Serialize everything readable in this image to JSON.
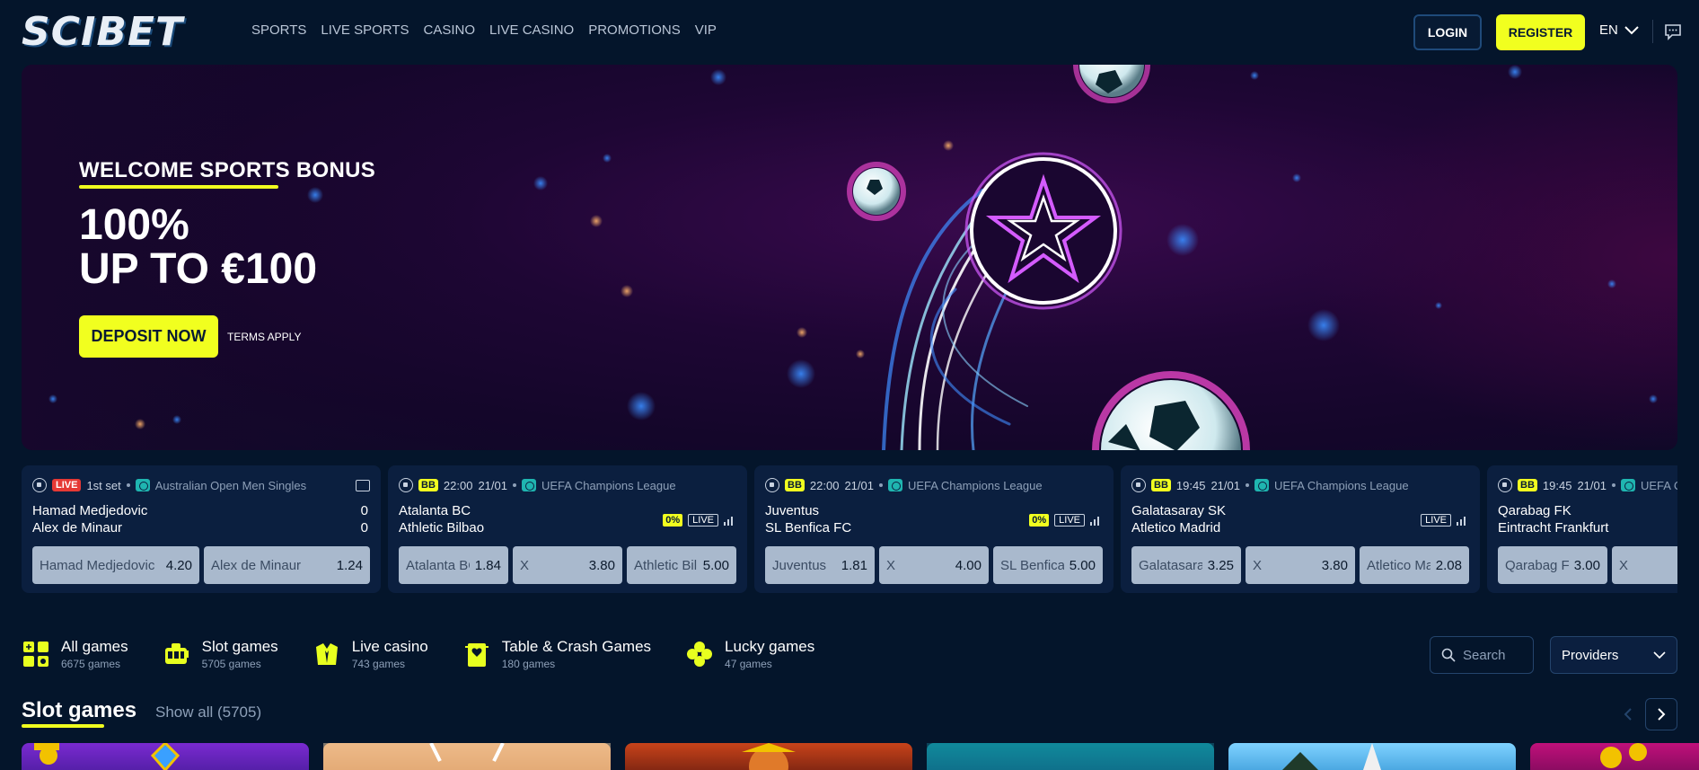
{
  "header": {
    "logo": "SCIBET",
    "nav": [
      "SPORTS",
      "LIVE SPORTS",
      "CASINO",
      "LIVE CASINO",
      "PROMOTIONS",
      "VIP"
    ],
    "login_label": "LOGIN",
    "register_label": "REGISTER",
    "language": "EN"
  },
  "hero": {
    "subtitle": "WELCOME SPORTS BONUS",
    "title_line1": "100%",
    "title_line2": "UP TO €100",
    "cta_label": "DEPOSIT NOW",
    "terms_label": "TERMS APPLY",
    "accent_color": "#f1ff1f"
  },
  "matches": [
    {
      "badge": "LIVE",
      "time": "1st set",
      "date": "",
      "league": "Australian Open Men Singles",
      "sport_icon": "tennis-icon",
      "home": "Hamad Medjedovic",
      "away": "Alex de Minaur",
      "home_score": "0",
      "away_score": "0",
      "tags": [],
      "odds": [
        {
          "name": "Hamad Medjedovic",
          "value": "4.20"
        },
        {
          "name": "Alex de Minaur",
          "value": "1.24"
        }
      ]
    },
    {
      "badge": "BB",
      "time": "22:00",
      "date": "21/01",
      "league": "UEFA Champions League",
      "sport_icon": "football-icon",
      "home": "Atalanta BC",
      "away": "Athletic Bilbao",
      "tags": [
        "0%",
        "LIVE"
      ],
      "odds": [
        {
          "name": "Atalanta BC",
          "value": "1.84"
        },
        {
          "name": "X",
          "value": "3.80"
        },
        {
          "name": "Athletic Bilbao",
          "value": "5.00"
        }
      ]
    },
    {
      "badge": "BB",
      "time": "22:00",
      "date": "21/01",
      "league": "UEFA Champions League",
      "sport_icon": "football-icon",
      "home": "Juventus",
      "away": "SL Benfica FC",
      "tags": [
        "0%",
        "LIVE"
      ],
      "odds": [
        {
          "name": "Juventus",
          "value": "1.81"
        },
        {
          "name": "X",
          "value": "4.00"
        },
        {
          "name": "SL Benfica FC",
          "value": "5.00"
        }
      ]
    },
    {
      "badge": "BB",
      "time": "19:45",
      "date": "21/01",
      "league": "UEFA Champions League",
      "sport_icon": "football-icon",
      "home": "Galatasaray SK",
      "away": "Atletico Madrid",
      "tags": [
        "LIVE"
      ],
      "odds": [
        {
          "name": "Galatasaray SK",
          "value": "3.25"
        },
        {
          "name": "X",
          "value": "3.80"
        },
        {
          "name": "Atletico Madrid",
          "value": "2.08"
        }
      ]
    },
    {
      "badge": "BB",
      "time": "19:45",
      "date": "21/01",
      "league": "UEFA Champions League",
      "sport_icon": "football-icon",
      "home": "Qarabag FK",
      "away": "Eintracht Frankfurt",
      "tags": [],
      "odds": [
        {
          "name": "Qarabag FK",
          "value": "3.00"
        },
        {
          "name": "X",
          "value": ""
        }
      ]
    }
  ],
  "categories": [
    {
      "title": "All games",
      "count": "6675 games",
      "icon": "grid-icon"
    },
    {
      "title": "Slot games",
      "count": "5705 games",
      "icon": "slot-machine-icon"
    },
    {
      "title": "Live casino",
      "count": "743 games",
      "icon": "dealer-icon"
    },
    {
      "title": "Table & Crash Games",
      "count": "180 games",
      "icon": "cards-icon"
    },
    {
      "title": "Lucky games",
      "count": "47 games",
      "icon": "clover-icon"
    }
  ],
  "search": {
    "placeholder": "Search"
  },
  "providers_label": "Providers",
  "slot_section": {
    "title": "Slot games",
    "show_all": "Show all (5705)"
  }
}
